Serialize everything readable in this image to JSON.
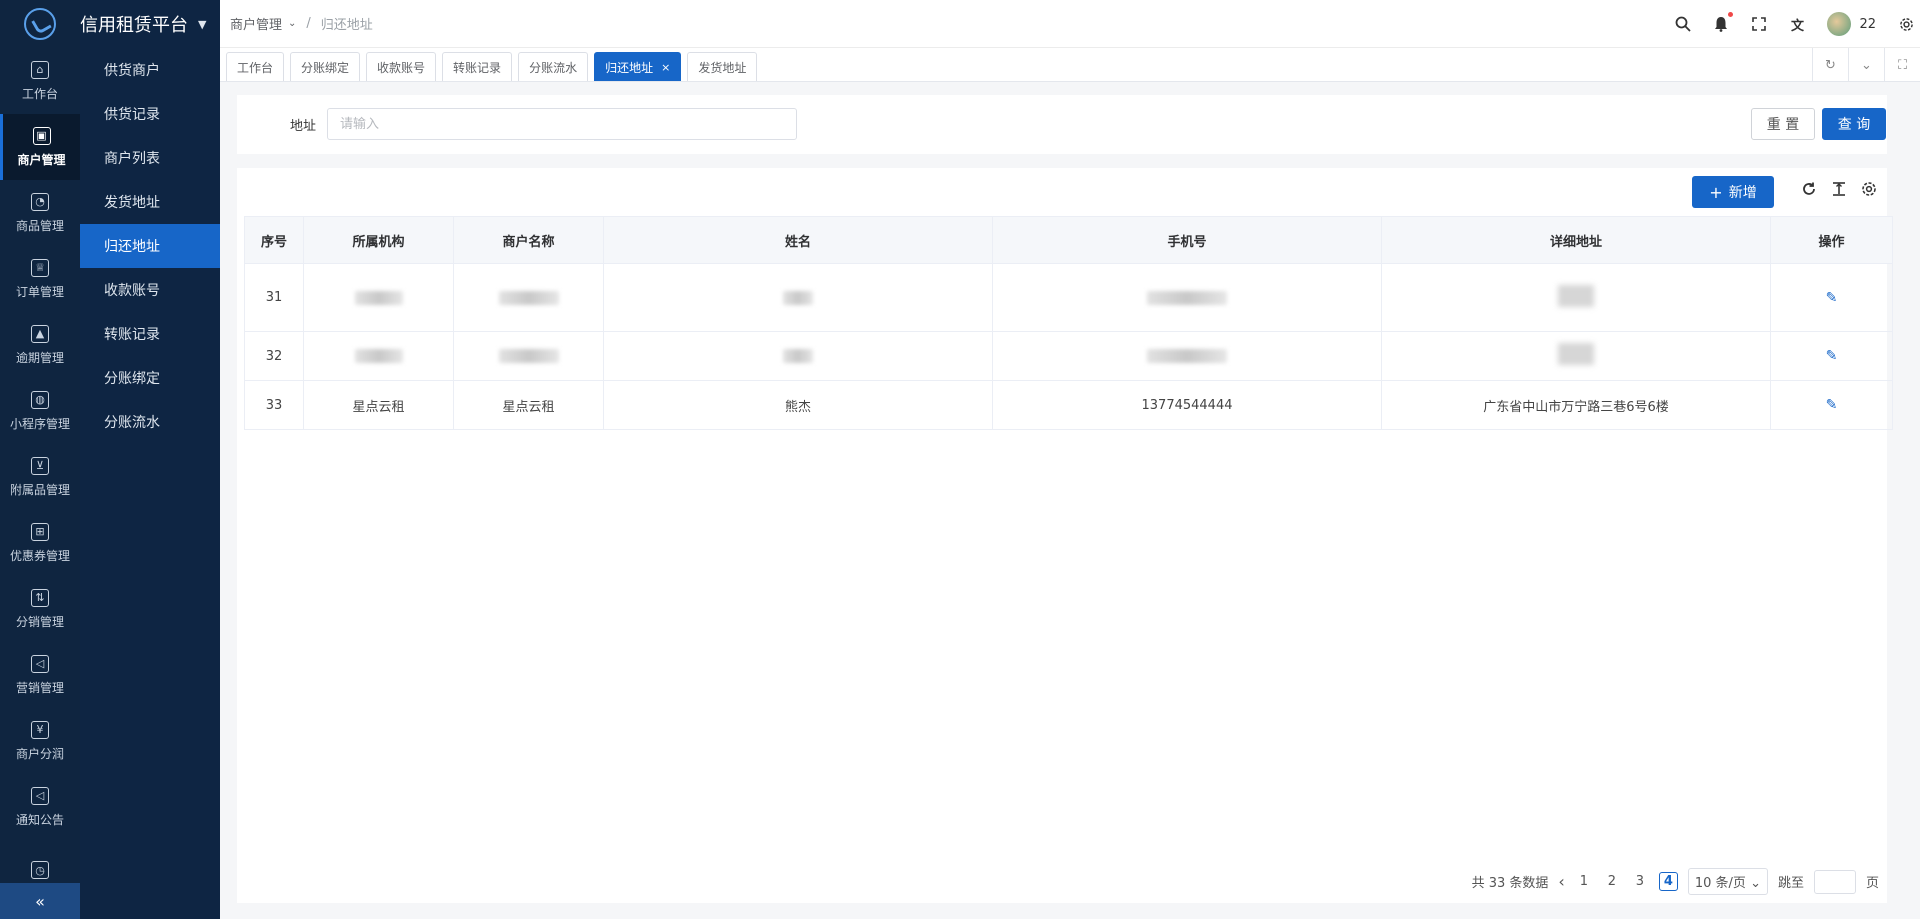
{
  "rail": {
    "items": [
      {
        "label": "工作台",
        "icon": "⌂",
        "active": false
      },
      {
        "label": "商户管理",
        "icon": "▣",
        "active": true
      },
      {
        "label": "商品管理",
        "icon": "◔",
        "active": false
      },
      {
        "label": "订单管理",
        "icon": "♕",
        "active": false
      },
      {
        "label": "逾期管理",
        "icon": "▲",
        "active": false
      },
      {
        "label": "小程序管理",
        "icon": "◍",
        "active": false
      },
      {
        "label": "附属品管理",
        "icon": "⊻",
        "active": false
      },
      {
        "label": "优惠券管理",
        "icon": "⊞",
        "active": false
      },
      {
        "label": "分销管理",
        "icon": "⇅",
        "active": false
      },
      {
        "label": "营销管理",
        "icon": "◁",
        "active": false
      },
      {
        "label": "商户分润",
        "icon": "¥",
        "active": false
      },
      {
        "label": "通知公告",
        "icon": "◁",
        "active": false
      },
      {
        "label": "",
        "icon": "◷",
        "active": false
      }
    ],
    "collapse_icon": "«"
  },
  "brand": {
    "title": "信用租赁平台",
    "pin_icon": "📌"
  },
  "submenu": {
    "items": [
      {
        "label": "供货商户",
        "active": false
      },
      {
        "label": "供货记录",
        "active": false
      },
      {
        "label": "商户列表",
        "active": false
      },
      {
        "label": "发货地址",
        "active": false
      },
      {
        "label": "归还地址",
        "active": true
      },
      {
        "label": "收款账号",
        "active": false
      },
      {
        "label": "转账记录",
        "active": false
      },
      {
        "label": "分账绑定",
        "active": false
      },
      {
        "label": "分账流水",
        "active": false
      }
    ]
  },
  "header": {
    "breadcrumb_parent": "商户管理",
    "breadcrumb_sep": "/",
    "breadcrumb_current": "归还地址",
    "user_name": "22",
    "icons": {
      "search": "⚲",
      "bell": "🔔︎",
      "fullscreen": "⤢",
      "translate": "文",
      "settings": "⚙"
    }
  },
  "tabs": {
    "items": [
      {
        "label": "工作台",
        "active": false
      },
      {
        "label": "分账绑定",
        "active": false
      },
      {
        "label": "收款账号",
        "active": false
      },
      {
        "label": "转账记录",
        "active": false
      },
      {
        "label": "分账流水",
        "active": false
      },
      {
        "label": "归还地址",
        "active": true
      },
      {
        "label": "发货地址",
        "active": false
      }
    ],
    "close_icon": "×",
    "right_icons": [
      "↻",
      "⌄",
      "⛶"
    ]
  },
  "search": {
    "label": "地址",
    "placeholder": "请输入",
    "value": "",
    "reset_label": "重 置",
    "query_label": "查 询"
  },
  "toolbar": {
    "add_label": "新增",
    "add_icon": "+",
    "icons": [
      "↻",
      "⊤",
      "⚙"
    ]
  },
  "table": {
    "columns": [
      "序号",
      "所属机构",
      "商户名称",
      "姓名",
      "手机号",
      "详细地址",
      "操作"
    ],
    "rows": [
      {
        "index": "31",
        "org": "",
        "merchant": "",
        "name": "",
        "phone": "",
        "address": "",
        "blurred": true
      },
      {
        "index": "32",
        "org": "",
        "merchant": "",
        "name": "",
        "phone": "",
        "address": "",
        "blurred": true
      },
      {
        "index": "33",
        "org": "星点云租",
        "merchant": "星点云租",
        "name": "熊杰",
        "phone": "13774544444",
        "address": "广东省中山市万宁路三巷6号6楼",
        "blurred": false
      }
    ],
    "edit_icon": "✎"
  },
  "pagination": {
    "total_text": "共 33 条数据",
    "prev_icon": "‹",
    "pages": [
      "1",
      "2",
      "3",
      "4"
    ],
    "current_page": "4",
    "page_size": "10 条/页",
    "jump_label": "跳至",
    "page_suffix": "页"
  },
  "colors": {
    "primary": "#1766c8",
    "sidebar": "#0f2540",
    "submenu": "#0e2543"
  }
}
